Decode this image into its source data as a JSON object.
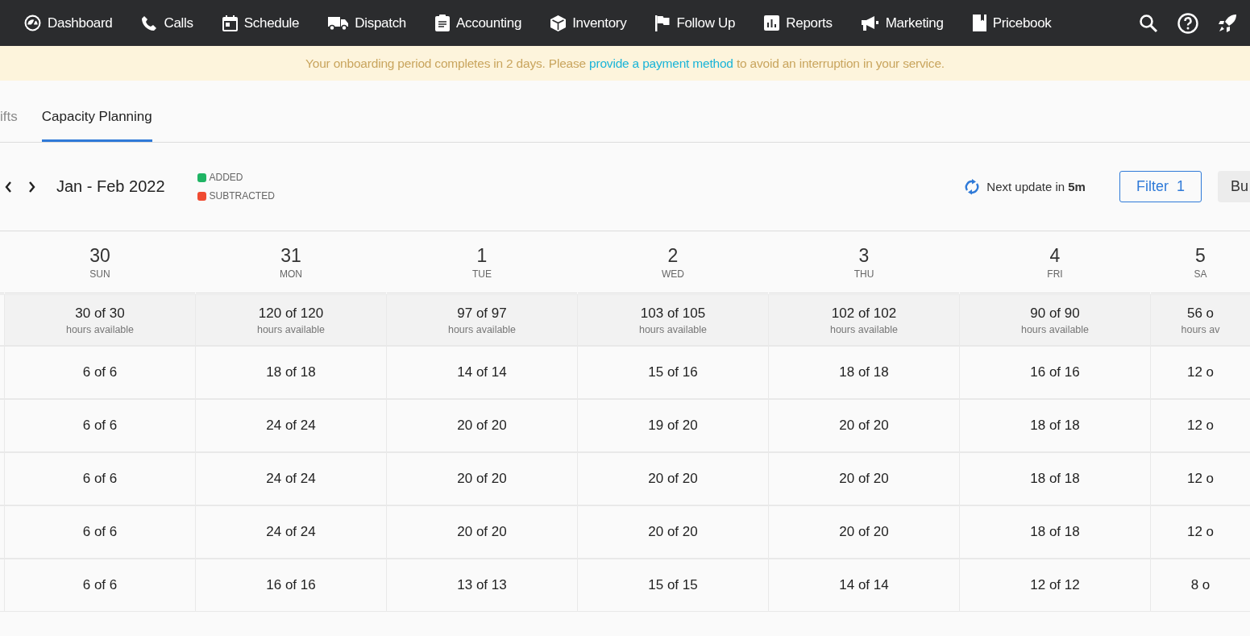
{
  "nav": {
    "items": [
      {
        "label": "Dashboard"
      },
      {
        "label": "Calls"
      },
      {
        "label": "Schedule"
      },
      {
        "label": "Dispatch"
      },
      {
        "label": "Accounting"
      },
      {
        "label": "Inventory"
      },
      {
        "label": "Follow Up"
      },
      {
        "label": "Reports"
      },
      {
        "label": "Marketing"
      },
      {
        "label": "Pricebook"
      }
    ]
  },
  "banner": {
    "text": "Your onboarding period completes in 2 days. Please ",
    "link": "provide a payment method",
    "text_after": " to avoid an interruption in your service."
  },
  "tabs": [
    {
      "label": "ifts",
      "selected": false
    },
    {
      "label": "Capacity Planning",
      "selected": true
    }
  ],
  "toolbar": {
    "date_range": "Jan - Feb 2022",
    "legend": [
      {
        "label": "ADDED",
        "color": "#1fb464"
      },
      {
        "label": "SUBTRACTED",
        "color": "#f04b32"
      }
    ],
    "update": "Next update in **5m**",
    "filter_button": "Filter  1",
    "button_2": "Bu"
  },
  "days": [
    {
      "day": "30",
      "weekday": "SUN",
      "summary": "30 of 30",
      "summary_label": "hours available",
      "cells": [
        "6 of 6",
        "6 of 6",
        "6 of 6",
        "6 of 6",
        "6 of 6"
      ]
    },
    {
      "day": "31",
      "weekday": "MON",
      "summary": "120 of 120",
      "summary_label": "hours available",
      "cells": [
        "18 of 18",
        "24 of 24",
        "24 of 24",
        "24 of 24",
        "16 of 16"
      ]
    },
    {
      "day": "1",
      "weekday": "TUE",
      "summary": "97 of 97",
      "summary_label": "hours available",
      "cells": [
        "14 of 14",
        "20 of 20",
        "20 of 20",
        "20 of 20",
        "13 of 13"
      ]
    },
    {
      "day": "2",
      "weekday": "WED",
      "summary": "103 of 105",
      "summary_label": "hours available",
      "cells": [
        "15 of 16",
        "19 of 20",
        "20 of 20",
        "20 of 20",
        "15 of 15"
      ]
    },
    {
      "day": "3",
      "weekday": "THU",
      "summary": "102 of 102",
      "summary_label": "hours available",
      "cells": [
        "18 of 18",
        "20 of 20",
        "20 of 20",
        "20 of 20",
        "14 of 14"
      ]
    },
    {
      "day": "4",
      "weekday": "FRI",
      "summary": "90 of 90",
      "summary_label": "hours available",
      "cells": [
        "16 of 16",
        "18 of 18",
        "18 of 18",
        "18 of 18",
        "12 of 12"
      ]
    },
    {
      "day": "5",
      "weekday": "SA",
      "summary": "56 o",
      "summary_label": "hours av",
      "cells": [
        "12 o",
        "12 o",
        "12 o",
        "12 o",
        "8 o"
      ]
    }
  ]
}
